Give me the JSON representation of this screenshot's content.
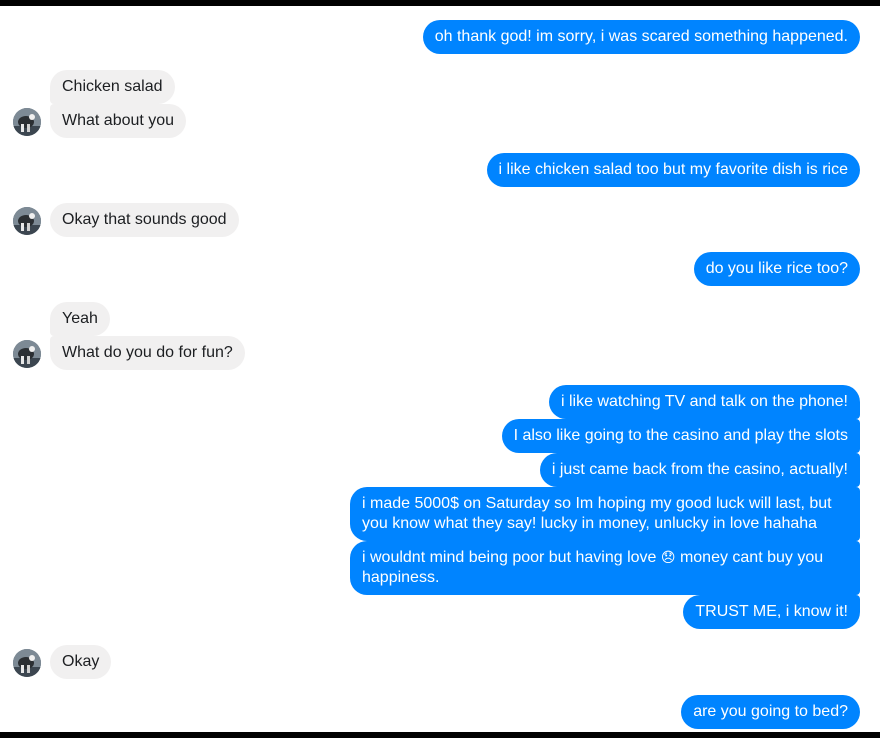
{
  "colors": {
    "outgoing_bubble": "#0084ff",
    "incoming_bubble": "#f1f0f0",
    "background": "#ffffff",
    "frame": "#000000"
  },
  "messages": {
    "m1": "oh thank god! im sorry, i was scared something happened.",
    "m2": "Chicken salad",
    "m3": "What about you",
    "m4": "i like chicken salad too but my favorite dish is rice",
    "m5": "Okay that sounds good",
    "m6": "do you like rice too?",
    "m7": "Yeah",
    "m8": "What do you do for fun?",
    "m9": "i like watching TV and talk on the phone!",
    "m10": "I also like going to the casino and play the slots",
    "m11": "i just came back from the casino, actually!",
    "m12": "i made 5000$ on Saturday so Im hoping my good luck will last, but you know what they say! lucky in money, unlucky in love hahaha",
    "m13_before": "i wouldnt mind being poor but having love",
    "m13_emoji": "😞",
    "m13_after": "money cant buy you happiness.",
    "m14": "TRUST ME, i know it!",
    "m15": "Okay",
    "m16": "are you going to bed?"
  },
  "icons": {
    "contact_avatar": "avatar-icon",
    "sad_emoji": "sad-face-emoji"
  }
}
